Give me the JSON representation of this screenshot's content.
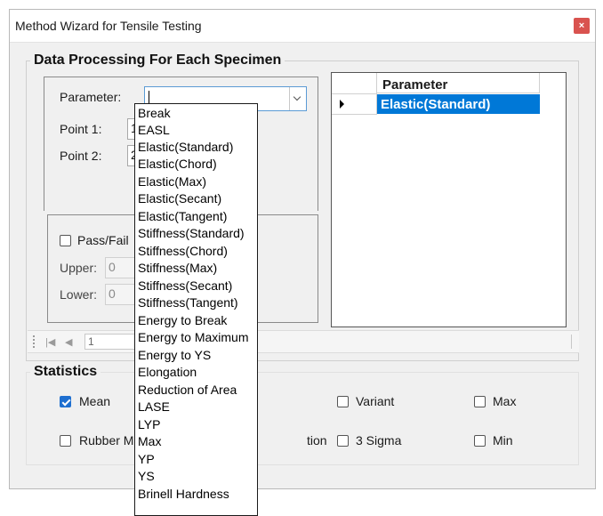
{
  "window": {
    "title": "Method Wizard for Tensile Testing",
    "close_glyph": "×"
  },
  "data_processing": {
    "legend": "Data Processing For Each Specimen",
    "parameter_label": "Parameter:",
    "parameter_value": "",
    "point1_label": "Point 1:",
    "point1_value": "10",
    "point2_label": "Point 2:",
    "point2_value": "20",
    "pass_fail_label": "Pass/Fail",
    "pass_fail_checked": false,
    "upper_label": "Upper:",
    "upper_value": "0",
    "lower_label": "Lower:",
    "lower_value": "0"
  },
  "parameter_grid": {
    "column_header": "Parameter",
    "rows": [
      "Elastic(Standard)"
    ]
  },
  "navigator": {
    "first_glyph": "|◀",
    "prev_glyph": "◀",
    "page_value": "1"
  },
  "statistics": {
    "legend": "Statistics",
    "items": [
      {
        "label": "Mean",
        "checked": true
      },
      {
        "label": "Variant",
        "checked": false
      },
      {
        "label": "Max",
        "checked": false
      },
      {
        "label": "Rubber M",
        "checked": false
      },
      {
        "label": "tion",
        "checked": false
      },
      {
        "label": "3 Sigma",
        "checked": false
      },
      {
        "label": "Min",
        "checked": false
      }
    ]
  },
  "dropdown_options": [
    "Break",
    "EASL",
    "Elastic(Standard)",
    "Elastic(Chord)",
    "Elastic(Max)",
    "Elastic(Secant)",
    "Elastic(Tangent)",
    "Stiffness(Standard)",
    "Stiffness(Chord)",
    "Stiffness(Max)",
    "Stiffness(Secant)",
    "Stiffness(Tangent)",
    "Energy to Break",
    "Energy to Maximum",
    "Energy to YS",
    "Elongation",
    "Reduction of Area",
    "LASE",
    "LYP",
    "Max",
    "YP",
    "YS",
    "Brinell Hardness"
  ],
  "colors": {
    "selection": "#0078d7",
    "close": "#d9534f",
    "checkbox_checked": "#1e6fd0"
  }
}
